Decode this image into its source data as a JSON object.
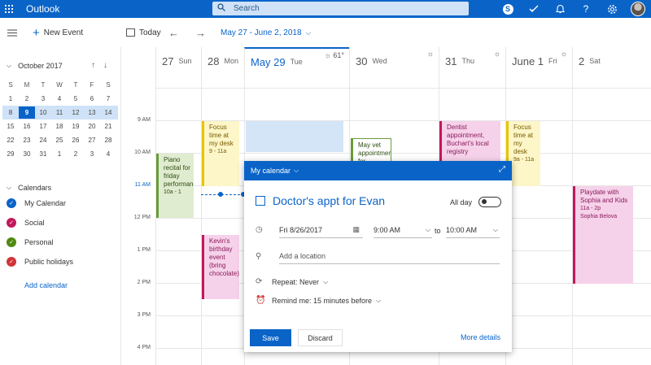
{
  "topbar": {
    "app_name": "Outlook",
    "search_placeholder": "Search",
    "accent": "#0a64c8"
  },
  "cmdbar": {
    "new_event": "New Event",
    "today": "Today",
    "range": "May 27 - June 2, 2018"
  },
  "mini_calendar": {
    "month_label": "October 2017",
    "weekdays": [
      "S",
      "M",
      "T",
      "W",
      "T",
      "F",
      "S"
    ],
    "weeks": [
      [
        "1",
        "2",
        "3",
        "4",
        "5",
        "6",
        "7"
      ],
      [
        "8",
        "9",
        "10",
        "11",
        "12",
        "13",
        "14"
      ],
      [
        "15",
        "16",
        "17",
        "18",
        "19",
        "20",
        "21"
      ],
      [
        "22",
        "23",
        "24",
        "25",
        "26",
        "27",
        "28"
      ],
      [
        "29",
        "30",
        "31",
        "1",
        "2",
        "3",
        "4"
      ]
    ],
    "today": "9"
  },
  "calendars": {
    "heading": "Calendars",
    "items": [
      {
        "label": "My Calendar",
        "color": "#0a64c8"
      },
      {
        "label": "Social",
        "color": "#c2185b"
      },
      {
        "label": "Personal",
        "color": "#4f8a10"
      },
      {
        "label": "Public holidays",
        "color": "#d13438"
      }
    ],
    "add_label": "Add calendar"
  },
  "days": [
    {
      "num": "27",
      "name": "Sun",
      "weather": ""
    },
    {
      "num": "28",
      "name": "Mon",
      "weather": ""
    },
    {
      "num": "May 29",
      "name": "Tue",
      "weather": "61°"
    },
    {
      "num": "30",
      "name": "Wed",
      "weather": ""
    },
    {
      "num": "31",
      "name": "Thu",
      "weather": ""
    },
    {
      "num": "June 1",
      "name": "Fri",
      "weather": ""
    },
    {
      "num": "2",
      "name": "Sat",
      "weather": ""
    }
  ],
  "time_labels": [
    "9 AM",
    "10 AM",
    "11 AM",
    "12 PM",
    "1 PM",
    "2 PM",
    "3 PM",
    "4 PM"
  ],
  "events": {
    "piano": {
      "title": "Piano recital for friday performance",
      "time": "10a - 1"
    },
    "focus_mon": {
      "title": "Focus time at my desk",
      "time": "9 - 11a"
    },
    "kevin": {
      "title": "Kevin's birthday event (bring chocolate)",
      "time": ""
    },
    "vet": {
      "title": "May vet appointment for",
      "time": ""
    },
    "dentist": {
      "title": "Dentist appointment, Buchart's local registry",
      "time": ""
    },
    "focus_fri": {
      "title": "Focus time at my desk",
      "time": "9a - 11a"
    },
    "playdate": {
      "title": "Playdate with Sophia and Kids",
      "time": "11a - 2p",
      "who": "Sophia Belova"
    }
  },
  "popup": {
    "calendar_label": "My calendar",
    "title": "Doctor's appt for Evan",
    "all_day": "All day",
    "start_date": "Fri 8/26/2017",
    "start_time": "9:00 AM",
    "to": "to",
    "end_time": "10:00 AM",
    "location_placeholder": "Add a location",
    "repeat": "Repeat: Never",
    "remind": "Remind me: 15 minutes before",
    "save": "Save",
    "discard": "Discard",
    "more": "More details"
  }
}
